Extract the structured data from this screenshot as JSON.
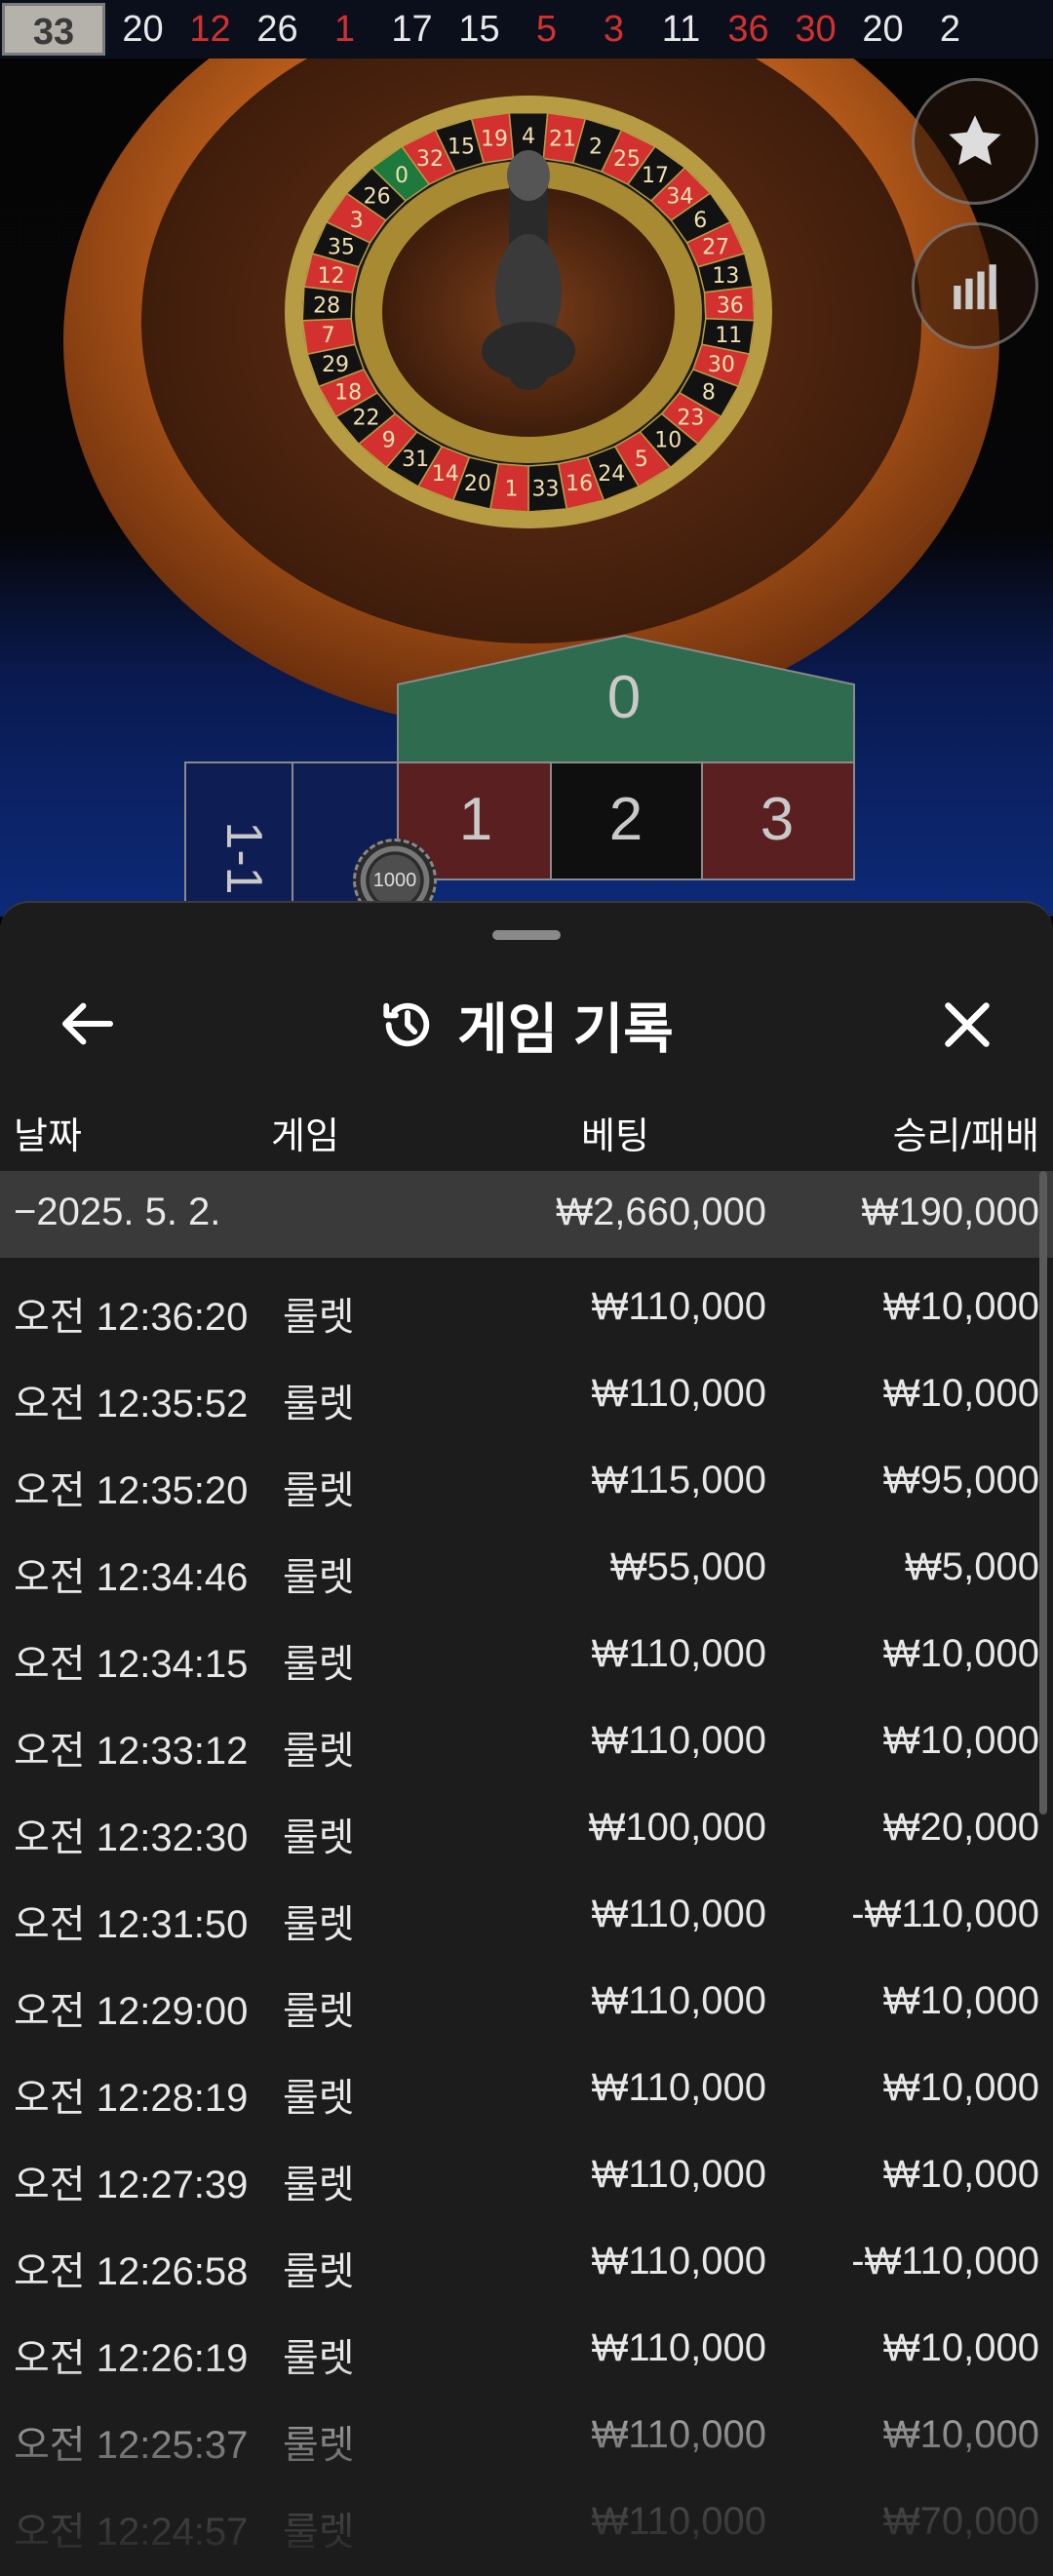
{
  "results_strip": {
    "current": "33",
    "numbers": [
      {
        "value": "20",
        "color": "black"
      },
      {
        "value": "12",
        "color": "red"
      },
      {
        "value": "26",
        "color": "black"
      },
      {
        "value": "1",
        "color": "red"
      },
      {
        "value": "17",
        "color": "black"
      },
      {
        "value": "15",
        "color": "black"
      },
      {
        "value": "5",
        "color": "red"
      },
      {
        "value": "3",
        "color": "red"
      },
      {
        "value": "11",
        "color": "black"
      },
      {
        "value": "36",
        "color": "red"
      },
      {
        "value": "30",
        "color": "red"
      },
      {
        "value": "20",
        "color": "black"
      },
      {
        "value": "2",
        "color": "black"
      }
    ]
  },
  "side_buttons": {
    "favorite_icon": "star-icon",
    "stats_icon": "bar-chart-icon"
  },
  "table": {
    "zero": "0",
    "numbers": [
      "1",
      "2",
      "3"
    ],
    "side_label": "1-1",
    "chip": "1000"
  },
  "history": {
    "title": "게임 기록",
    "columns": {
      "date": "날짜",
      "game": "게임",
      "bet": "베팅",
      "result": "승리/패배"
    },
    "summary": {
      "date": "−2025. 5. 2.",
      "bet": "₩2,660,000",
      "result": "₩190,000"
    },
    "rows": [
      {
        "time": "오전 12:36:20",
        "game": "룰렛",
        "bet": "₩110,000",
        "result": "₩10,000"
      },
      {
        "time": "오전 12:35:52",
        "game": "룰렛",
        "bet": "₩110,000",
        "result": "₩10,000"
      },
      {
        "time": "오전 12:35:20",
        "game": "룰렛",
        "bet": "₩115,000",
        "result": "₩95,000"
      },
      {
        "time": "오전 12:34:46",
        "game": "룰렛",
        "bet": "₩55,000",
        "result": "₩5,000"
      },
      {
        "time": "오전 12:34:15",
        "game": "룰렛",
        "bet": "₩110,000",
        "result": "₩10,000"
      },
      {
        "time": "오전 12:33:12",
        "game": "룰렛",
        "bet": "₩110,000",
        "result": "₩10,000"
      },
      {
        "time": "오전 12:32:30",
        "game": "룰렛",
        "bet": "₩100,000",
        "result": "₩20,000"
      },
      {
        "time": "오전 12:31:50",
        "game": "룰렛",
        "bet": "₩110,000",
        "result": "-₩110,000"
      },
      {
        "time": "오전 12:29:00",
        "game": "룰렛",
        "bet": "₩110,000",
        "result": "₩10,000"
      },
      {
        "time": "오전 12:28:19",
        "game": "룰렛",
        "bet": "₩110,000",
        "result": "₩10,000"
      },
      {
        "time": "오전 12:27:39",
        "game": "룰렛",
        "bet": "₩110,000",
        "result": "₩10,000"
      },
      {
        "time": "오전 12:26:58",
        "game": "룰렛",
        "bet": "₩110,000",
        "result": "-₩110,000"
      },
      {
        "time": "오전 12:26:19",
        "game": "룰렛",
        "bet": "₩110,000",
        "result": "₩10,000"
      },
      {
        "time": "오전 12:25:37",
        "game": "룰렛",
        "bet": "₩110,000",
        "result": "₩10,000"
      },
      {
        "time": "오전 12:24:57",
        "game": "룰렛",
        "bet": "₩110,000",
        "result": "₩70,000"
      }
    ]
  },
  "wheel_numbers": [
    "0",
    "32",
    "15",
    "19",
    "4",
    "21",
    "2",
    "25",
    "17",
    "34",
    "6",
    "27",
    "13",
    "36",
    "11",
    "30",
    "8",
    "23",
    "10",
    "5",
    "24",
    "16",
    "33",
    "1",
    "20",
    "14",
    "31",
    "9",
    "22",
    "18",
    "29",
    "7",
    "28",
    "12",
    "35",
    "3",
    "26"
  ],
  "colors": {
    "red": "#d2312f",
    "green": "#1d7a3c",
    "felt_green": "#2f6b4e",
    "felt_red": "#5a1f21",
    "sheet": "#1c1c1c",
    "summary_row": "#3a3a3a"
  }
}
